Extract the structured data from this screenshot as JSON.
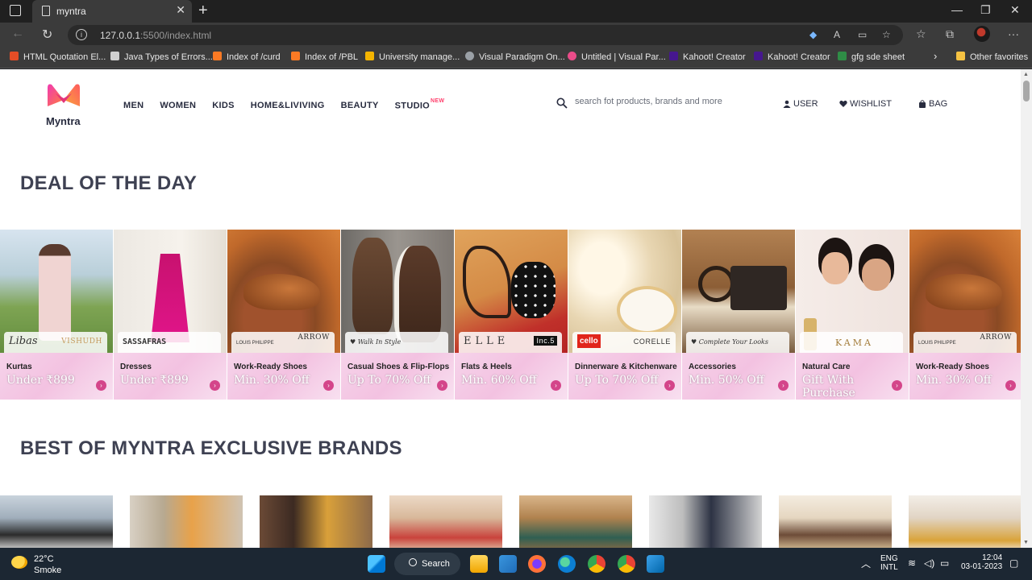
{
  "browser": {
    "tab_title": "myntra",
    "url_host": "127.0.0.1",
    "url_rest": ":5500/index.html",
    "bookmarks": [
      {
        "label": "HTML Quotation El...",
        "color": "#e44d26"
      },
      {
        "label": "Java Types of Errors...",
        "color": "#cfcfcf"
      },
      {
        "label": "Index of /curd",
        "color": "#fb7a24"
      },
      {
        "label": "Index of /PBL",
        "color": "#fb7a24"
      },
      {
        "label": "University manage...",
        "color": "#f4b400"
      },
      {
        "label": "Visual Paradigm On...",
        "color": "#9aa0a6"
      },
      {
        "label": "Untitled | Visual Par...",
        "color": "#ea4c89"
      },
      {
        "label": "Kahoot! Creator",
        "color": "#46178f"
      },
      {
        "label": "Kahoot! Creator",
        "color": "#46178f"
      },
      {
        "label": "gfg sde sheet",
        "color": "#2f8d46"
      }
    ],
    "other_favorites": "Other favorites"
  },
  "site": {
    "logo_text": "Myntra",
    "nav": [
      "MEN",
      "WOMEN",
      "KIDS",
      "HOME&LIVIVING",
      "BEAUTY",
      "STUDIO"
    ],
    "studio_badge": "NEW",
    "search_placeholder": "search fot products, brands and more",
    "user_label": "USER",
    "wishlist_label": "WISHLIST",
    "bag_label": "BAG",
    "accent": "#ff3f6c"
  },
  "deal_section": {
    "title": "DEAL OF THE DAY",
    "cards": [
      {
        "category": "Kurtas",
        "offer": "Under ₹899",
        "brand_left": "Libas",
        "brand_right": "VISHUDH"
      },
      {
        "category": "Dresses",
        "offer": "Under ₹899",
        "brand_left": "SASSAFRAS",
        "brand_right": ""
      },
      {
        "category": "Work-Ready Shoes",
        "offer": "Min. 30% Off",
        "brand_left": "LOUIS PHILIPPE",
        "brand_right": "ARROW"
      },
      {
        "category": "Casual Shoes & Flip-Flops",
        "offer": "Up To 70% Off",
        "brand_left": "Walk In Style",
        "brand_right": ""
      },
      {
        "category": "Flats & Heels",
        "offer": "Min. 60% Off",
        "brand_left": "ELLE",
        "brand_right": "Inc.5"
      },
      {
        "category": "Dinnerware & Kitchenware",
        "offer": "Up To 70% Off",
        "brand_left": "cello",
        "brand_right": "CORELLE"
      },
      {
        "category": "Accessories",
        "offer": "Min. 50% Off",
        "brand_left": "Complete Your Looks",
        "brand_right": ""
      },
      {
        "category": "Natural Care",
        "offer": "Gift With Purchase",
        "brand_left": "KAMA",
        "brand_right": ""
      },
      {
        "category": "Work-Ready Shoes",
        "offer": "Min. 30% Off",
        "brand_left": "LOUIS PHILIPPE",
        "brand_right": "ARROW"
      }
    ]
  },
  "brands_section": {
    "title": "BEST OF MYNTRA EXCLUSIVE BRANDS"
  },
  "taskbar": {
    "temp": "22°C",
    "condition": "Smoke",
    "search_label": "Search",
    "lang1": "ENG",
    "lang2": "INTL",
    "time": "12:04",
    "date": "03-01-2023"
  }
}
